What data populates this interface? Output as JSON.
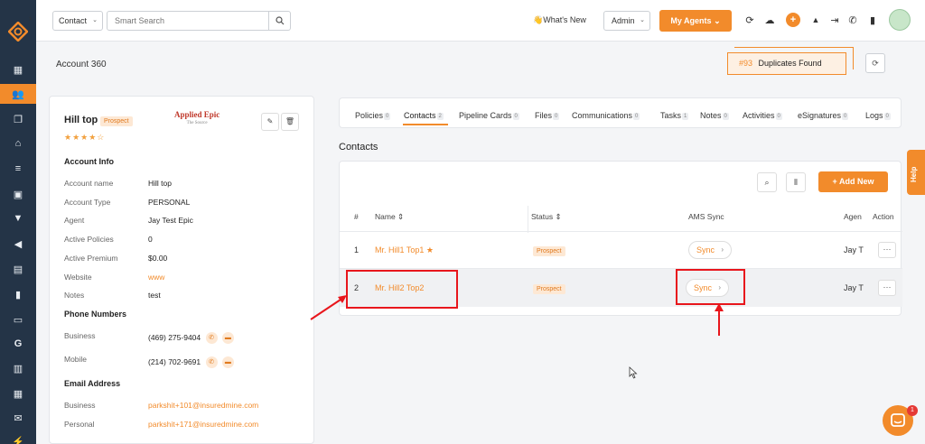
{
  "topbar": {
    "context_select": "Contact",
    "search_placeholder": "Smart Search",
    "whats_new": "👋What's New",
    "role_select": "Admin",
    "my_agents": "My Agents ⌄"
  },
  "page": {
    "title": "Account 360",
    "duplicates_count": "#93",
    "duplicates_label": "Duplicates Found"
  },
  "account": {
    "name": "Hill top",
    "status": "Prospect",
    "stars": "★★★★☆",
    "logo_main": "Applied Epic",
    "logo_sub": "The Source",
    "info_title": "Account Info",
    "fields": [
      {
        "label": "Account name",
        "value": "Hill top"
      },
      {
        "label": "Account Type",
        "value": "PERSONAL"
      },
      {
        "label": "Agent",
        "value": "Jay Test Epic"
      },
      {
        "label": "Active Policies",
        "value": "0"
      },
      {
        "label": "Active Premium",
        "value": "$0.00"
      },
      {
        "label": "Website",
        "value": "www"
      },
      {
        "label": "Notes",
        "value": "test"
      }
    ],
    "phone_title": "Phone Numbers",
    "phones": [
      {
        "label": "Business",
        "value": "(469) 275-9404"
      },
      {
        "label": "Mobile",
        "value": "(214) 702-9691"
      }
    ],
    "email_title": "Email Address",
    "emails": [
      {
        "label": "Business",
        "value": "parkshit+101@insuredmine.com"
      },
      {
        "label": "Personal",
        "value": "parkshit+171@insuredmine.com"
      }
    ]
  },
  "tabs": [
    {
      "label": "Policies",
      "count": "0"
    },
    {
      "label": "Contacts",
      "count": "2"
    },
    {
      "label": "Pipeline Cards",
      "count": "0"
    },
    {
      "label": "Files",
      "count": "0"
    },
    {
      "label": "Communications",
      "count": "0"
    },
    {
      "label": "Tasks",
      "count": "1"
    },
    {
      "label": "Notes",
      "count": "0"
    },
    {
      "label": "Activities",
      "count": "0"
    },
    {
      "label": "eSignatures",
      "count": "0"
    },
    {
      "label": "Logs",
      "count": "0"
    }
  ],
  "contacts": {
    "title": "Contacts",
    "add_new": "+ Add New",
    "columns": [
      "#",
      "Name ⇕",
      "Status ⇕",
      "AMS Sync",
      "Agen",
      "Action"
    ],
    "rows": [
      {
        "num": "1",
        "name": "Mr. Hill1 Top1 ★",
        "status": "Prospect",
        "sync": "Sync",
        "agent": "Jay T"
      },
      {
        "num": "2",
        "name": "Mr. Hill2 Top2",
        "status": "Prospect",
        "sync": "Sync",
        "agent": "Jay T"
      }
    ]
  },
  "help_label": "Help",
  "chat_badge": "1",
  "colors": {
    "accent": "#f28b2b",
    "rail": "#243447",
    "annotation": "#e8161c"
  }
}
